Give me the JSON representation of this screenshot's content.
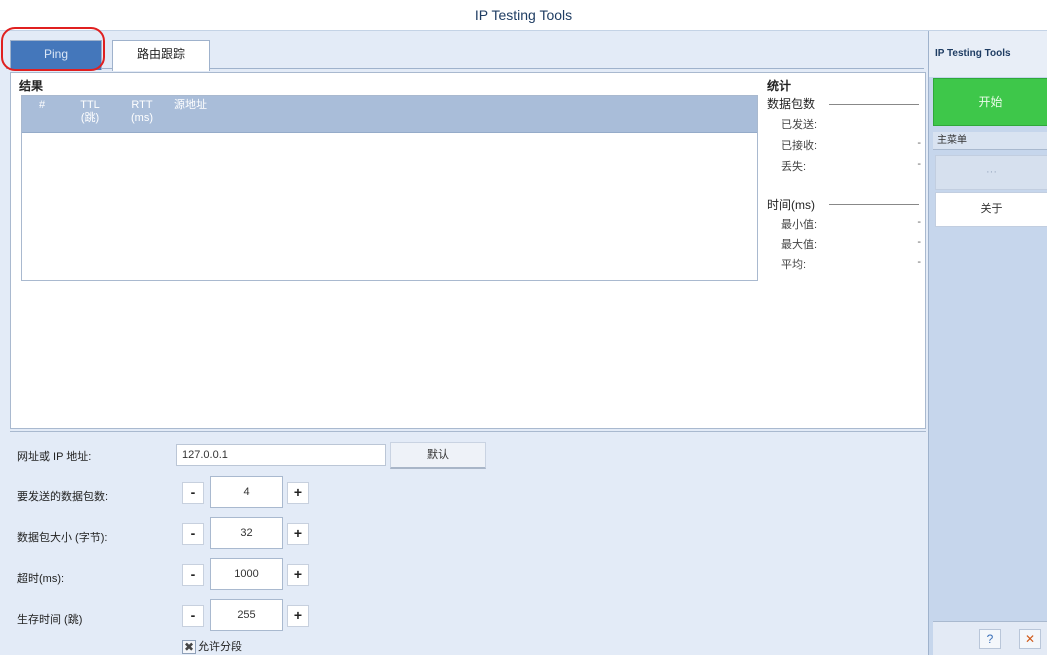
{
  "window": {
    "title": "IP Testing Tools"
  },
  "tabs": [
    {
      "label": "Ping",
      "active": true
    },
    {
      "label": "路由跟踪",
      "active": false
    }
  ],
  "results": {
    "title": "结果",
    "columns": [
      "#",
      "TTL\n(跳)",
      "RTT\n(ms)",
      "源地址"
    ],
    "rows": []
  },
  "stats": {
    "title": "统计",
    "packets": {
      "label": "数据包数",
      "items": [
        {
          "label": "已发送:",
          "value": ""
        },
        {
          "label": "已接收:",
          "value": "-"
        },
        {
          "label": "丢失:",
          "value": "-"
        }
      ]
    },
    "time": {
      "label": "时间(ms)",
      "items": [
        {
          "label": "最小值:",
          "value": "-"
        },
        {
          "label": "最大值:",
          "value": "-"
        },
        {
          "label": "平均:",
          "value": "-"
        }
      ]
    }
  },
  "settings": {
    "ip_label": "网址或 IP 地址:",
    "ip_value": "127.0.0.1",
    "default_label": "默认",
    "fields": [
      {
        "label": "要发送的数据包数:",
        "value": "4"
      },
      {
        "label": "数据包大小 (字节):",
        "value": "32"
      },
      {
        "label": "超时(ms):",
        "value": "1000"
      },
      {
        "label": "生存时间 (跳)",
        "value": "255"
      }
    ],
    "minus": "-",
    "plus": "+",
    "allow_fragment_label": "允许分段",
    "allow_fragment_checked": true
  },
  "sidebar": {
    "title": "IP Testing Tools",
    "start_label": "开始",
    "menu_label": "主菜单",
    "menu_items": [
      {
        "label": "···",
        "disabled": true
      },
      {
        "label": "关于",
        "disabled": false
      }
    ],
    "help_icon": "help-icon",
    "close_icon": "close-icon"
  },
  "colors": {
    "accent_tab": "#4477bb",
    "start_green": "#3ec74a",
    "highlight": "#e02020"
  }
}
